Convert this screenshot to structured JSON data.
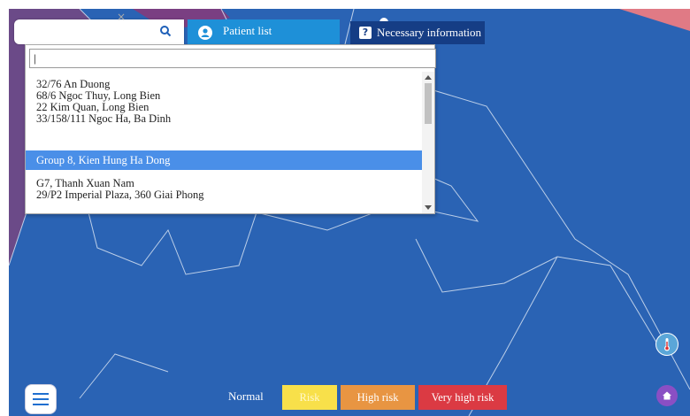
{
  "search": {
    "value": "",
    "placeholder": ""
  },
  "toolbar": {
    "patient_list_label": "Patient list",
    "necessary_info_label": "Necessary information",
    "clear_symbol": "×"
  },
  "dropdown": {
    "search_value": "|",
    "items": [
      {
        "lines": [
          "32/76 An Duong",
          "68/6 Ngoc Thuy, Long Bien",
          "22 Kim Quan, Long Bien",
          "33/158/111 Ngoc Ha, Ba Dinh"
        ],
        "selected": false
      },
      {
        "lines": [
          "Group 8, Kien Hung Ha Dong"
        ],
        "selected": true
      },
      {
        "lines": [
          "G7, Thanh Xuan Nam",
          "29/P2 Imperial Plaza, 360 Giai Phong"
        ],
        "selected": false
      }
    ]
  },
  "legend": {
    "normal": "Normal",
    "risk": "Risk",
    "high_risk": "High risk",
    "very_high_risk": "Very high risk"
  },
  "colors": {
    "map_fill": "#2a63b4",
    "risk": "#f8e04a",
    "high_risk": "#e89542",
    "very_high_risk": "#db3a43",
    "accent": "#1e90d8"
  },
  "icons": [
    "search-icon",
    "user-icon",
    "question-icon",
    "menu-icon",
    "thermometer-icon",
    "home-icon"
  ]
}
